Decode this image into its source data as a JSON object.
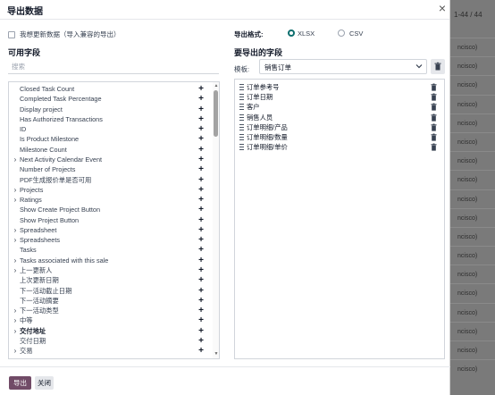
{
  "background": {
    "pager": "1-44 / 44",
    "rows": [
      "ncisco)",
      "ncisco)",
      "ncisco)",
      "ncisco)",
      "ncisco)",
      "ncisco)",
      "ncisco)",
      "ncisco)",
      "ncisco)",
      "ncisco)",
      "ncisco)",
      "ncisco)",
      "ncisco)",
      "ncisco)",
      "ncisco)",
      "ncisco)",
      "ncisco)",
      "ncisco)"
    ]
  },
  "dialog": {
    "title": "导出数据",
    "update_checkbox_label": "我想更新数据（导入兼容的导出）",
    "format_label": "导出格式:",
    "formats": [
      "XLSX",
      "CSV"
    ],
    "selected_format": "XLSX",
    "available_title": "可用字段",
    "search_placeholder": "搜索",
    "export_title": "要导出的字段",
    "template_label": "模板:",
    "template_value": "销售订单",
    "available_fields": [
      {
        "label": "Closed Task Count",
        "expandable": false,
        "bold": false
      },
      {
        "label": "Completed Task Percentage",
        "expandable": false,
        "bold": false
      },
      {
        "label": "Display project",
        "expandable": false,
        "bold": false
      },
      {
        "label": "Has Authorized Transactions",
        "expandable": false,
        "bold": false
      },
      {
        "label": "ID",
        "expandable": false,
        "bold": false
      },
      {
        "label": "Is Product Milestone",
        "expandable": false,
        "bold": false
      },
      {
        "label": "Milestone Count",
        "expandable": false,
        "bold": false
      },
      {
        "label": "Next Activity Calendar Event",
        "expandable": true,
        "bold": false
      },
      {
        "label": "Number of Projects",
        "expandable": false,
        "bold": false
      },
      {
        "label": "PDF生成报价单是否可用",
        "expandable": false,
        "bold": false
      },
      {
        "label": "Projects",
        "expandable": true,
        "bold": false
      },
      {
        "label": "Ratings",
        "expandable": true,
        "bold": false
      },
      {
        "label": "Show Create Project Button",
        "expandable": false,
        "bold": false
      },
      {
        "label": "Show Project Button",
        "expandable": false,
        "bold": false
      },
      {
        "label": "Spreadsheet",
        "expandable": true,
        "bold": false
      },
      {
        "label": "Spreadsheets",
        "expandable": true,
        "bold": false
      },
      {
        "label": "Tasks",
        "expandable": false,
        "bold": false
      },
      {
        "label": "Tasks associated with this sale",
        "expandable": true,
        "bold": false
      },
      {
        "label": "上一更新人",
        "expandable": true,
        "bold": false
      },
      {
        "label": "上次更新日期",
        "expandable": false,
        "bold": false
      },
      {
        "label": "下一活动截止日期",
        "expandable": false,
        "bold": false
      },
      {
        "label": "下一活动摘要",
        "expandable": false,
        "bold": false
      },
      {
        "label": "下一活动类型",
        "expandable": true,
        "bold": false
      },
      {
        "label": "中等",
        "expandable": true,
        "bold": false
      },
      {
        "label": "交付地址",
        "expandable": true,
        "bold": true
      },
      {
        "label": "交付日期",
        "expandable": false,
        "bold": false
      },
      {
        "label": "交易",
        "expandable": true,
        "bold": false
      }
    ],
    "selected_fields": [
      "订单参考号",
      "订单日期",
      "客户",
      "销售人员",
      "订单明细/产品",
      "订单明细/数量",
      "订单明细/单价"
    ],
    "export_button": "导出",
    "close_button": "关闭",
    "colors": {
      "primary": "#714b67",
      "radio_accent": "#0d6e6e"
    }
  }
}
